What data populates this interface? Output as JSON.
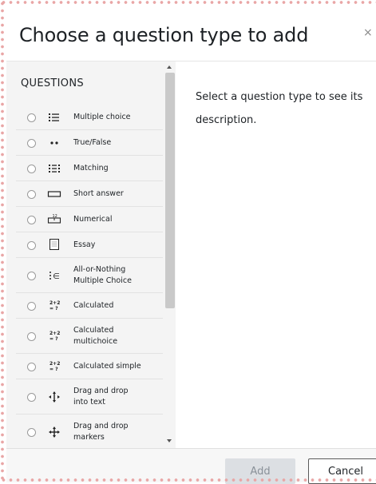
{
  "dialog": {
    "title": "Choose a question type to add",
    "close_label": "×"
  },
  "options": {
    "heading": "QUESTIONS",
    "items": [
      {
        "label": "Multiple choice",
        "icon": "multiple-choice-icon"
      },
      {
        "label": "True/False",
        "icon": "true-false-icon"
      },
      {
        "label": "Matching",
        "icon": "matching-icon"
      },
      {
        "label": "Short answer",
        "icon": "short-answer-icon"
      },
      {
        "label": "Numerical",
        "icon": "numerical-icon"
      },
      {
        "label": "Essay",
        "icon": "essay-icon"
      },
      {
        "label_line1": "All-or-Nothing",
        "label_line2": "Multiple Choice",
        "icon": "all-or-nothing-icon"
      },
      {
        "label": "Calculated",
        "icon": "calculated-icon"
      },
      {
        "label_line1": "Calculated",
        "label_line2": "multichoice",
        "icon": "calculated-multichoice-icon"
      },
      {
        "label": "Calculated simple",
        "icon": "calculated-simple-icon"
      },
      {
        "label_line1": "Drag and drop",
        "label_line2": "into text",
        "icon": "drag-drop-text-icon"
      },
      {
        "label_line1": "Drag and drop",
        "label_line2": "markers",
        "icon": "drag-drop-markers-icon"
      }
    ],
    "calc_icon_text": {
      "top": "2+2",
      "bottom": "= ?"
    }
  },
  "description": {
    "text": "Select a question type to see its description."
  },
  "footer": {
    "add_label": "Add",
    "cancel_label": "Cancel"
  }
}
